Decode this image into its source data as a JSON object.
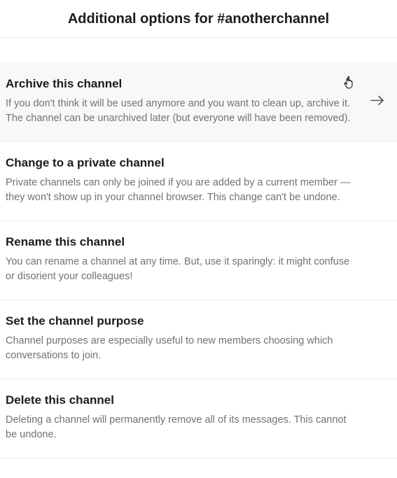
{
  "header": {
    "title_prefix": "Additional options for ",
    "channel": "#anotherchannel"
  },
  "options": [
    {
      "title": "Archive this channel",
      "description": "If you don't think it will be used anymore and you want to clean up, archive it. The channel can be unarchived later (but everyone will have been removed)."
    },
    {
      "title": "Change to a private channel",
      "description": "Private channels can only be joined if you are added by a current member — they won't show up in your channel browser. This change can't be undone."
    },
    {
      "title": "Rename this channel",
      "description": "You can rename a channel at any time. But, use it sparingly: it might confuse or disorient your colleagues!"
    },
    {
      "title": "Set the channel purpose",
      "description": "Channel purposes are especially useful to new members choosing which conversations to join."
    },
    {
      "title": "Delete this channel",
      "description": "Deleting a channel will permanently remove all of its messages. This cannot be undone."
    }
  ]
}
